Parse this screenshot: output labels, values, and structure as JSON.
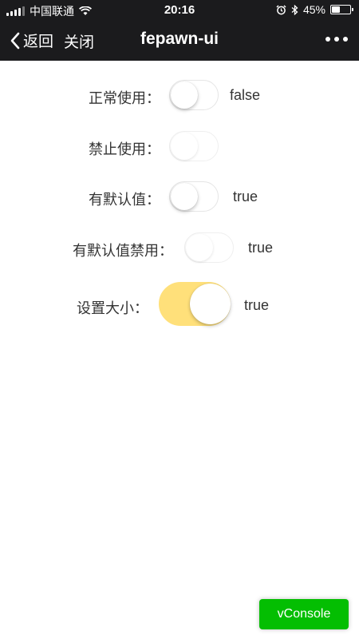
{
  "status": {
    "carrier": "中国联通",
    "time": "20:16",
    "battery": "45%"
  },
  "nav": {
    "back_label": "返回",
    "close_label": "关闭",
    "title": "fepawn-ui"
  },
  "rows": [
    {
      "label": "正常使用：",
      "value": "false"
    },
    {
      "label": "禁止使用：",
      "value": ""
    },
    {
      "label": "有默认值：",
      "value": "true"
    },
    {
      "label": "有默认值禁用：",
      "value": "true"
    },
    {
      "label": "设置大小：",
      "value": "true"
    }
  ],
  "vconsole_label": "vConsole",
  "colors": {
    "accent": "#ffe07a",
    "statusbar": "#1b1b1d",
    "vconsole": "#04be02"
  }
}
